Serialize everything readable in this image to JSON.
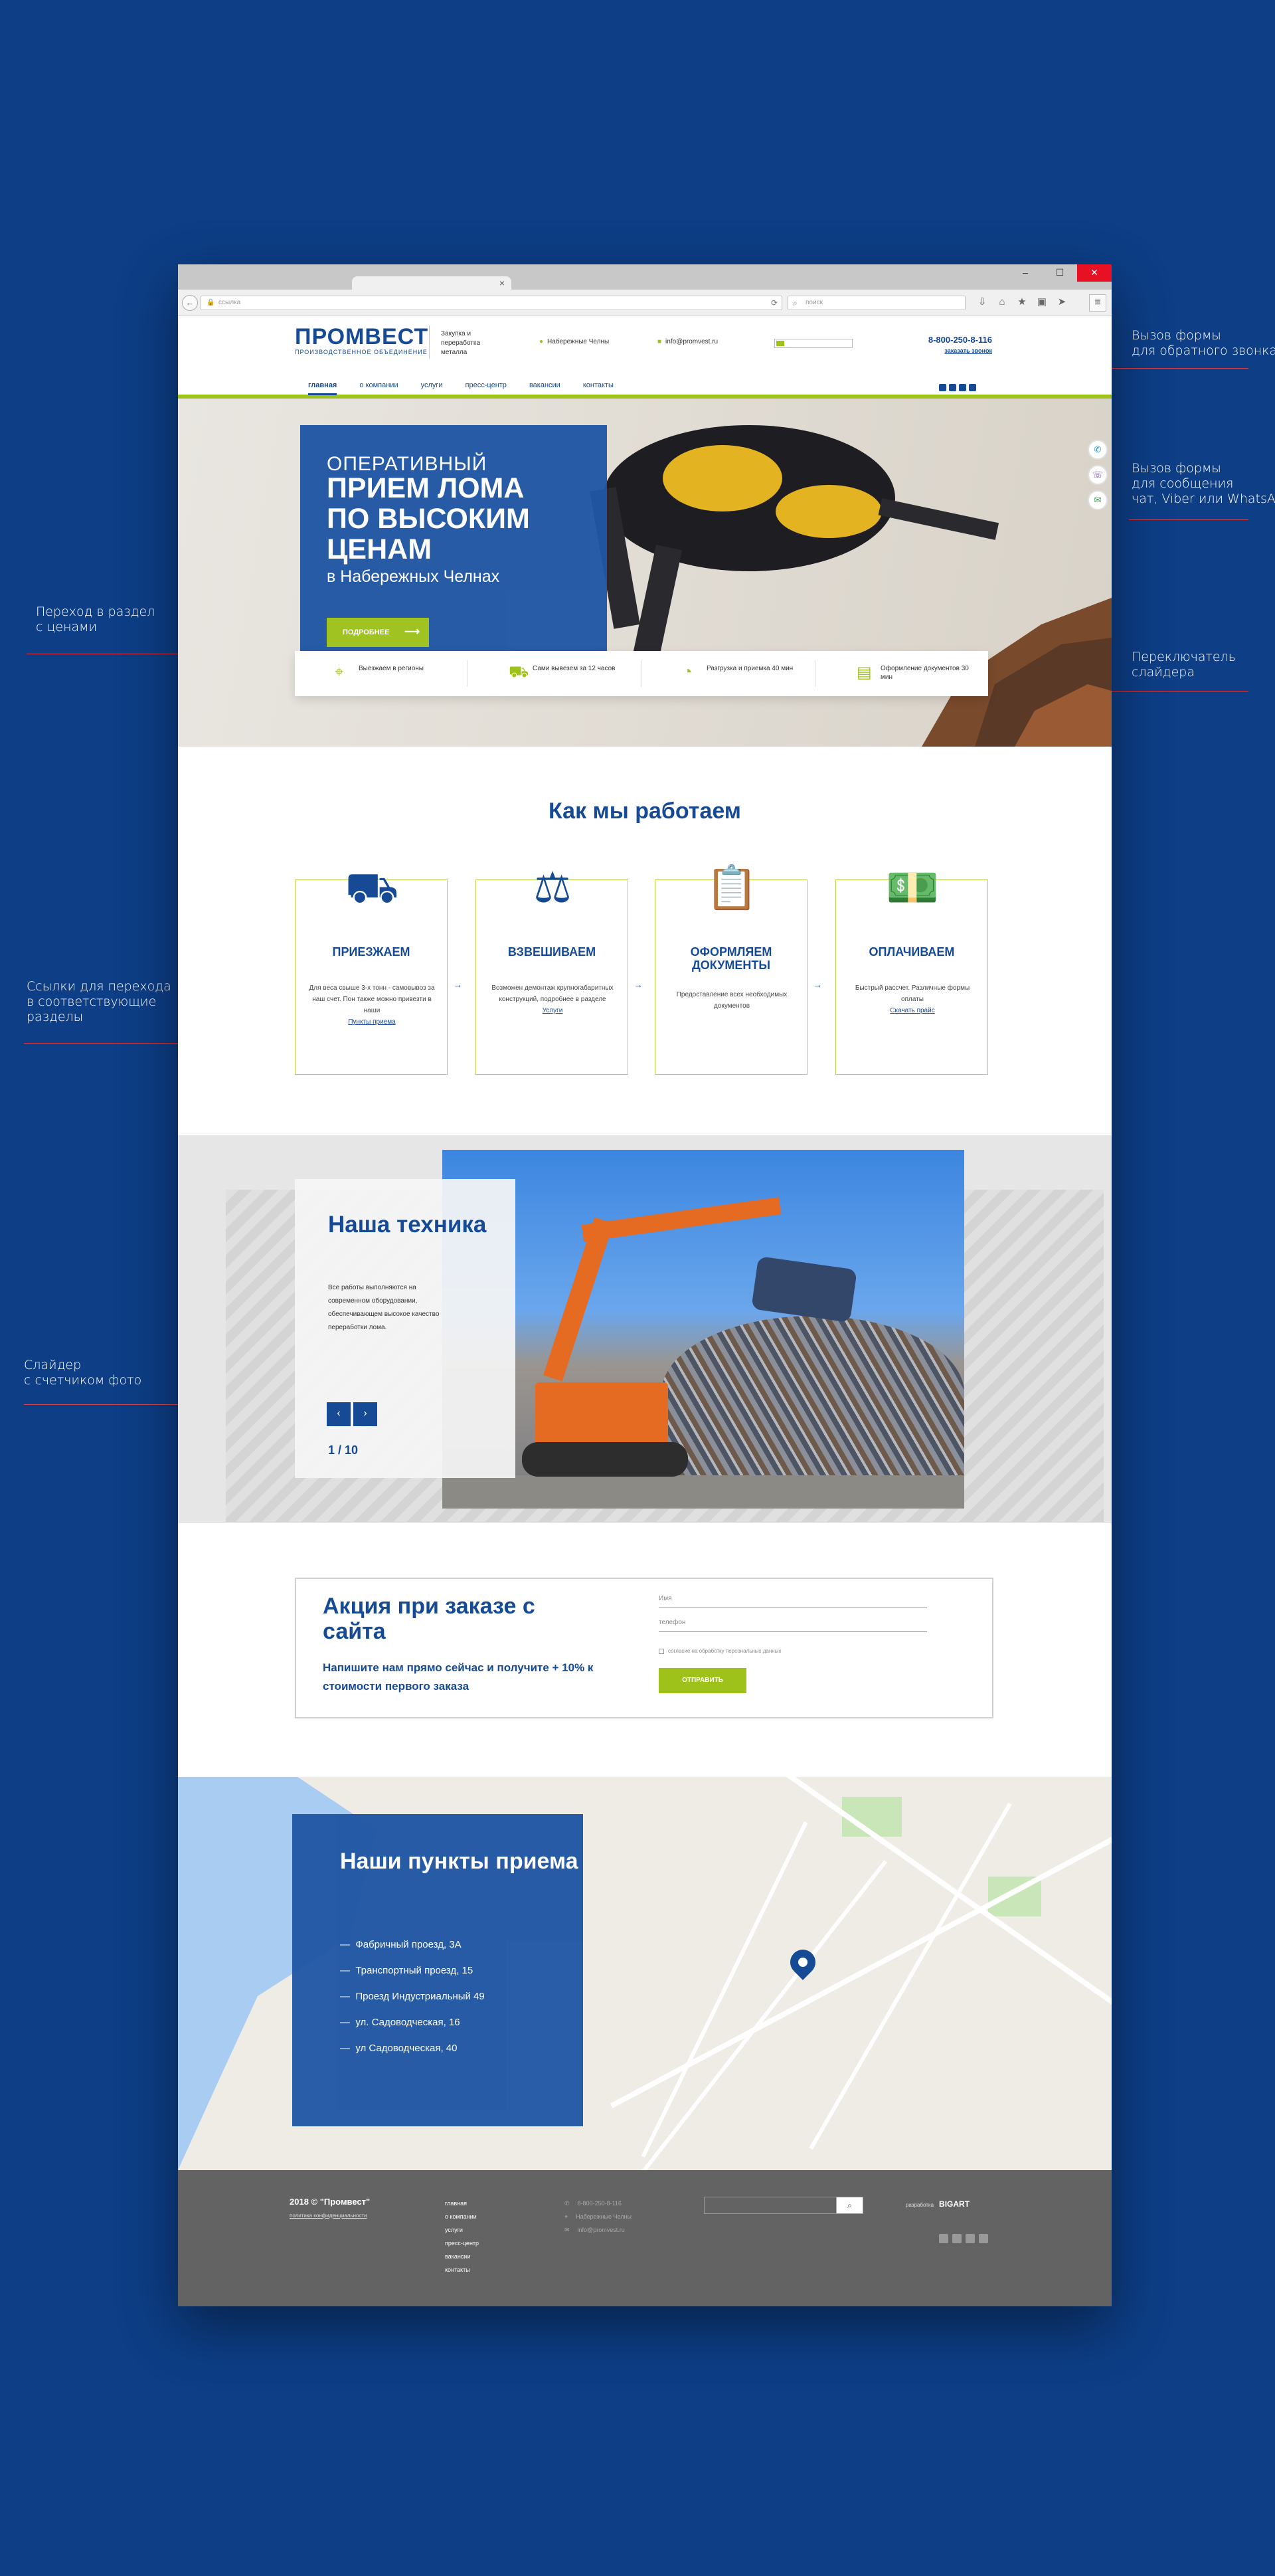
{
  "annotations": {
    "callback": "Вызов формы\nдля обратного звонка",
    "chat": "Вызов формы\nдля сообщения\nчат, Viber или WhatsApp",
    "prices": "Переход в раздел\nс ценами",
    "slider_switch": "Переключатель\nслайдера",
    "section_links": "Ссылки для перехода\nв соответствующие\nразделы",
    "photo_slider": "Слайдер\nс счетчиком фото"
  },
  "browser": {
    "url_placeholder": "ссылка",
    "search_placeholder": "поиск",
    "min_label": "–",
    "max_label": "☐",
    "close_label": "✕",
    "tab_close": "×",
    "back_icon": "←",
    "reload_icon": "⟳",
    "search_icon": "⌕",
    "lock_icon": "🔒",
    "icons": [
      "⇩",
      "⌂",
      "★",
      "▣",
      "➤"
    ],
    "menu_icon": "≡"
  },
  "header": {
    "logo_name": "ПРОМВЕСТ",
    "logo_sub": "ПРОИЗВОДСТВЕННОЕ ОБЪЕДИНЕНИЕ",
    "tagline": "Закупка и переработка металла",
    "address": "Набережные Челны",
    "email": "info@promvest.ru",
    "phone": "8-800-250-8-116",
    "callback_link": "заказать звонок"
  },
  "nav": {
    "items": [
      "главная",
      "о компании",
      "услуги",
      "пресс-центр",
      "вакансии",
      "контакты"
    ]
  },
  "hero": {
    "kicker": "ОПЕРАТИВНЫЙ",
    "title": "ПРИЕМ ЛОМА ПО ВЫСОКИМ ЦЕНАМ",
    "subtitle": "в Набережных Челнах",
    "button": "ПОДРОБНЕЕ",
    "button_arrow": "⟶",
    "prev": "‹",
    "next": "›",
    "side_icons": [
      "✆",
      "☏",
      "✉"
    ]
  },
  "features": [
    {
      "icon": "⌖",
      "text": "Выезжаем в регионы"
    },
    {
      "icon": "⛟",
      "text": "Сами вывезем за 12 часов"
    },
    {
      "icon": "◔",
      "text": "Разгрузка и приемка 40 мин"
    },
    {
      "icon": "▤",
      "text": "Оформление документов 30 мин"
    }
  ],
  "how": {
    "title": "Как мы работаем",
    "steps": [
      {
        "icon": "⛟",
        "name": "ПРИЕЗЖАЕМ",
        "desc": "Для веса свыше 3-х тонн - самовывоз за наш счет. Пон также можно привезти в наши",
        "link": "Пункты приема"
      },
      {
        "icon": "⚖",
        "name": "ВЗВЕШИВАЕМ",
        "desc": "Возможен демонтаж крупногабаритных конструкций, подробнее в разделе",
        "link": "Услуги"
      },
      {
        "icon": "📋",
        "name": "ОФОРМЛЯЕМ ДОКУМЕНТЫ",
        "desc": "Предоставление всех необходимых документов",
        "link": ""
      },
      {
        "icon": "💵",
        "name": "ОПЛАЧИВАЕМ",
        "desc": "Быстрый рассчет. Различные формы оплаты",
        "link": "Скачать прайс"
      }
    ],
    "arrow": "→"
  },
  "tech": {
    "title": "Наша техника",
    "desc": "Все работы выполняются на современном оборудовании, обеспечивающем высокое качество переработки лома.",
    "prev": "‹",
    "next": "›",
    "counter": "1 / 10"
  },
  "promo": {
    "title": "Акция при заказе с сайта",
    "text": "Напишите нам прямо сейчас и получите + 10% к стоимости первого заказа",
    "name_placeholder": "Имя",
    "phone_placeholder": "телефон",
    "consent": "согласие на обработку персональных данных",
    "button": "ОТПРАВИТЬ"
  },
  "map": {
    "title": "Наши пункты приема",
    "points": [
      "Фабричный проезд, 3А",
      "Транспортный проезд, 15",
      "Проезд Индустриальный 49",
      "ул. Садоводческая, 16",
      "ул Садоводческая, 40"
    ],
    "dash": "—"
  },
  "footer": {
    "copyright": "2018 © \"Промвест\"",
    "policy": "политика конфиденциальности",
    "nav": [
      "главная",
      "о компании",
      "услуги",
      "пресс-центр",
      "вакансии",
      "контакты"
    ],
    "phone": "8-800-250-8-116",
    "address": "Набережные Челны",
    "email": "info@promvest.ru",
    "search_icon": "⌕",
    "dev_label": "разработка",
    "dev_name": "BIGART"
  }
}
